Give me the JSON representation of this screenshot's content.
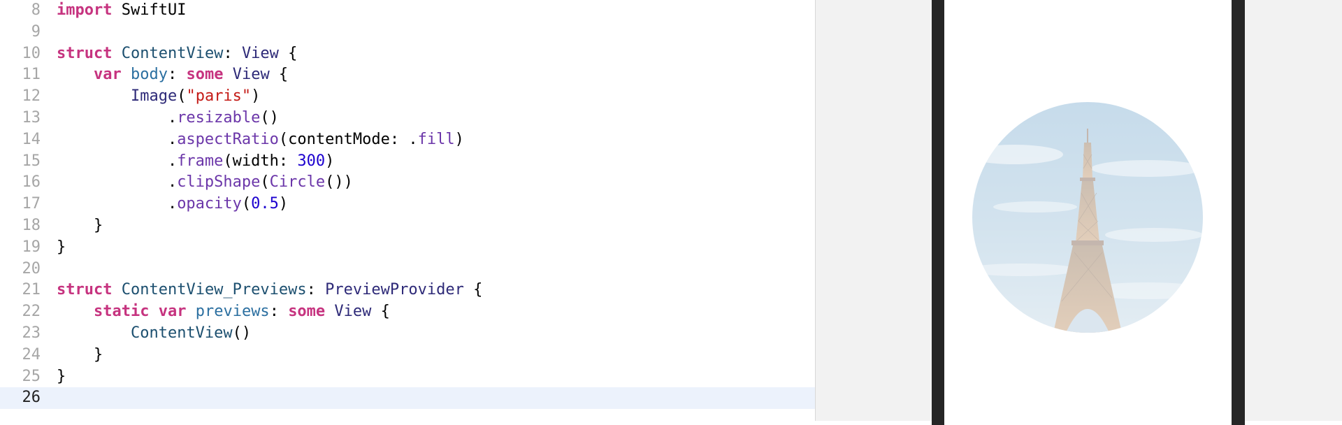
{
  "editor": {
    "current_line": "26",
    "lines": [
      {
        "num": "8",
        "tokens": [
          {
            "t": "import",
            "c": "kw"
          },
          {
            "t": " SwiftUI"
          }
        ]
      },
      {
        "num": "9",
        "tokens": []
      },
      {
        "num": "10",
        "tokens": [
          {
            "t": "struct",
            "c": "kw"
          },
          {
            "t": " "
          },
          {
            "t": "ContentView",
            "c": "ty"
          },
          {
            "t": ": "
          },
          {
            "t": "View",
            "c": "sysType"
          },
          {
            "t": " {"
          }
        ]
      },
      {
        "num": "11",
        "tokens": [
          {
            "t": "    "
          },
          {
            "t": "var",
            "c": "kw"
          },
          {
            "t": " "
          },
          {
            "t": "body",
            "c": "prop"
          },
          {
            "t": ": "
          },
          {
            "t": "some",
            "c": "kw"
          },
          {
            "t": " "
          },
          {
            "t": "View",
            "c": "sysType"
          },
          {
            "t": " {"
          }
        ]
      },
      {
        "num": "12",
        "tokens": [
          {
            "t": "        "
          },
          {
            "t": "Image",
            "c": "sysType"
          },
          {
            "t": "("
          },
          {
            "t": "\"paris\"",
            "c": "str"
          },
          {
            "t": ")"
          }
        ]
      },
      {
        "num": "13",
        "tokens": [
          {
            "t": "            ."
          },
          {
            "t": "resizable",
            "c": "fn"
          },
          {
            "t": "()"
          }
        ]
      },
      {
        "num": "14",
        "tokens": [
          {
            "t": "            ."
          },
          {
            "t": "aspectRatio",
            "c": "fn"
          },
          {
            "t": "(contentMode: ."
          },
          {
            "t": "fill",
            "c": "fn"
          },
          {
            "t": ")"
          }
        ]
      },
      {
        "num": "15",
        "tokens": [
          {
            "t": "            ."
          },
          {
            "t": "frame",
            "c": "fn"
          },
          {
            "t": "(width: "
          },
          {
            "t": "300",
            "c": "num"
          },
          {
            "t": ")"
          }
        ]
      },
      {
        "num": "16",
        "tokens": [
          {
            "t": "            ."
          },
          {
            "t": "clipShape",
            "c": "fn"
          },
          {
            "t": "("
          },
          {
            "t": "Circle",
            "c": "fn"
          },
          {
            "t": "())"
          }
        ]
      },
      {
        "num": "17",
        "tokens": [
          {
            "t": "            ."
          },
          {
            "t": "opacity",
            "c": "fn"
          },
          {
            "t": "("
          },
          {
            "t": "0.5",
            "c": "num"
          },
          {
            "t": ")"
          }
        ]
      },
      {
        "num": "18",
        "tokens": [
          {
            "t": "    }"
          }
        ]
      },
      {
        "num": "19",
        "tokens": [
          {
            "t": "}"
          }
        ]
      },
      {
        "num": "20",
        "tokens": []
      },
      {
        "num": "21",
        "tokens": [
          {
            "t": "struct",
            "c": "kw"
          },
          {
            "t": " "
          },
          {
            "t": "ContentView_Previews",
            "c": "ty"
          },
          {
            "t": ": "
          },
          {
            "t": "PreviewProvider",
            "c": "sysType"
          },
          {
            "t": " {"
          }
        ]
      },
      {
        "num": "22",
        "tokens": [
          {
            "t": "    "
          },
          {
            "t": "static",
            "c": "kw"
          },
          {
            "t": " "
          },
          {
            "t": "var",
            "c": "kw"
          },
          {
            "t": " "
          },
          {
            "t": "previews",
            "c": "prop"
          },
          {
            "t": ": "
          },
          {
            "t": "some",
            "c": "kw"
          },
          {
            "t": " "
          },
          {
            "t": "View",
            "c": "sysType"
          },
          {
            "t": " {"
          }
        ]
      },
      {
        "num": "23",
        "tokens": [
          {
            "t": "        "
          },
          {
            "t": "ContentView",
            "c": "ty"
          },
          {
            "t": "()"
          }
        ]
      },
      {
        "num": "24",
        "tokens": [
          {
            "t": "    }"
          }
        ]
      },
      {
        "num": "25",
        "tokens": [
          {
            "t": "}"
          }
        ]
      },
      {
        "num": "26",
        "tokens": []
      }
    ]
  },
  "preview": {
    "image_icon": "eiffel-tower-photo",
    "image_opacity": 0.5,
    "colors": {
      "canvas_bg": "#f2f2f2",
      "device_bezel": "#262626",
      "sky": "#9ec2dc"
    }
  }
}
